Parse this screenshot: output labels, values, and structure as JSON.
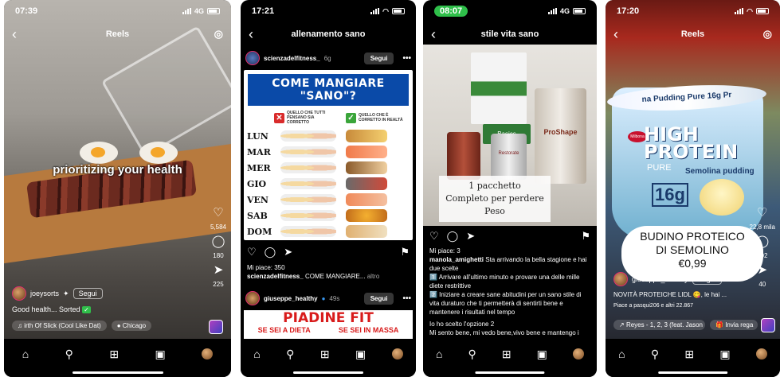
{
  "phones": [
    {
      "status_time": "07:39",
      "network": "4G",
      "header_title": "Reels",
      "overlay_text": "prioritizing your health",
      "likes": "5,584",
      "comments": "180",
      "shares": "225",
      "username": "joeysorts",
      "follow_label": "Segui",
      "caption": "Good health... Sorted",
      "music": "irth Of Slick (Cool Like Dat)",
      "location": "Chicago"
    },
    {
      "status_time": "17:21",
      "header_title": "allenamento sano",
      "post1": {
        "username": "scienzadelfitness_",
        "time": "6g",
        "follow_label": "Segui",
        "infographic": {
          "title": "COME MANGIARE \"SANO\"?",
          "col_wrong": "QUELLO CHE TUTTI PENSANO SIA CORRETTO",
          "col_right": "QUELLO CHE È CORRETTO IN REALTÀ",
          "days": [
            "LUN",
            "MAR",
            "MER",
            "GIO",
            "VEN",
            "SAB",
            "DOM"
          ]
        },
        "likes": "Mi piace: 350",
        "caption_user": "scienzadelfitness_",
        "caption_text": "COME MANGIARE...",
        "caption_more": "altro"
      },
      "post2": {
        "username": "giuseppe_healthy",
        "time": "49s",
        "follow_label": "Segui",
        "banner_title": "PIADINE FIT",
        "banner_left": "SE SEI A DIETA",
        "banner_right": "SE SEI IN MASSA"
      }
    },
    {
      "status_time": "08:07",
      "network": "4G",
      "header_title": "stile vita sano",
      "photo_caption_line1": "1 pacchetto",
      "photo_caption_line2": "Completo per perdere",
      "photo_caption_line3": "Peso",
      "box_label_1": "Basics",
      "box_label_2": "ProShape",
      "box_label_3": "Restorate",
      "likes": "Mi piace: 3",
      "caption_user": "manola_amighetti",
      "caption_text": "Sta arrivando la bella stagione e hai due scelte",
      "line1": "1️⃣ Arrivare all'ultimo minuto e provare una delle mille diete restrittive",
      "line2": "2️⃣ Iniziare a creare sane abitudini per un sano stile di vita duraturo che ti permetterà di sentirti bene e mantenere i risultati nel tempo",
      "line3": "Io ho scelto l'opzione 2",
      "line4": "Mi sento bene, mi vedo bene,vivo bene e mantengo i risultati nel tempo e senza privarmi di nulla"
    },
    {
      "status_time": "17:20",
      "header_title": "Reels",
      "cup_top_text": "na Pudding Pure 16g Pr",
      "cup_brand_line1": "HIGH",
      "cup_brand_line2": "PROTEIN",
      "cup_pure": "PURE",
      "cup_semolina": "Semolina pudding",
      "cup_16": "16g",
      "milbona": "Milbona",
      "bubble_line1": "BUDINO PROTEICO",
      "bubble_line2": "DI SEMOLINO",
      "bubble_price": "€0,99",
      "username": "giuseppe_healthy",
      "follow_label": "Segui",
      "caption": "NOVITÀ PROTEICHE LIDL 😋, le hai ...",
      "liked_by": "Piace a pasqui206 e altri 22.867",
      "likes": "22,8 mila",
      "comments": "102",
      "shares": "40",
      "music": "Reyes - 1, 2, 3 (feat. Jason",
      "gift_chip": "Invia rega"
    }
  ],
  "nav_icons": [
    "home-icon",
    "search-icon",
    "create-icon",
    "reels-icon",
    "profile-avatar"
  ]
}
